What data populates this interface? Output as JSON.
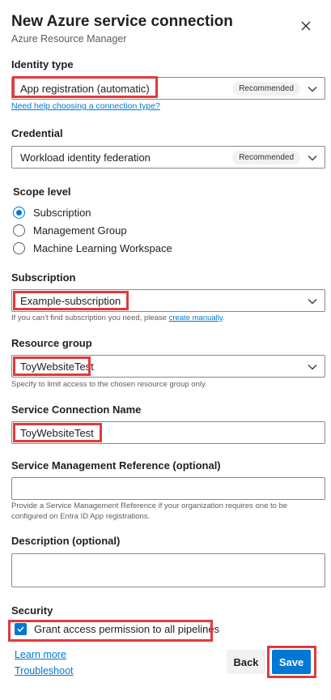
{
  "header": {
    "title": "New Azure service connection",
    "subtitle": "Azure Resource Manager"
  },
  "identity_type": {
    "label": "Identity type",
    "value": "App registration (automatic)",
    "badge": "Recommended",
    "help_link": "Need help choosing a connection type?"
  },
  "credential": {
    "label": "Credential",
    "value": "Workload identity federation",
    "badge": "Recommended"
  },
  "scope_level": {
    "label": "Scope level",
    "options": [
      "Subscription",
      "Management Group",
      "Machine Learning Workspace"
    ],
    "selected": "Subscription"
  },
  "subscription": {
    "label": "Subscription",
    "value": "Example-subscription",
    "hint_prefix": "If you can't find subscription you need, please ",
    "hint_link": "create manually",
    "hint_suffix": "."
  },
  "resource_group": {
    "label": "Resource group",
    "value": "ToyWebsiteTest",
    "hint": "Specify to limit access to the chosen resource group only."
  },
  "service_connection_name": {
    "label": "Service Connection Name",
    "value": "ToyWebsiteTest"
  },
  "service_management_reference": {
    "label": "Service Management Reference (optional)",
    "value": "",
    "hint_line1": "Provide a Service Management Reference if your organization requires one to be",
    "hint_line2": "configured on Entra ID App registrations."
  },
  "description": {
    "label": "Description (optional)",
    "value": ""
  },
  "security": {
    "label": "Security",
    "checkbox_label": "Grant access permission to all pipelines",
    "checked": true
  },
  "footer": {
    "learn_more": "Learn more",
    "troubleshoot": "Troubleshoot",
    "back_label": "Back",
    "save_label": "Save"
  },
  "colors": {
    "accent": "#0078d4",
    "highlight": "#e03a3e"
  }
}
